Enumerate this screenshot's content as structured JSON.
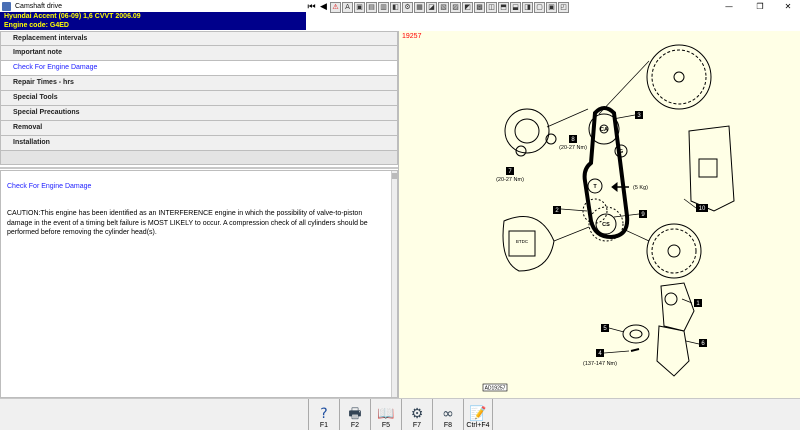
{
  "window": {
    "title": "Camshaft drive",
    "minimize": "—",
    "restore": "❐",
    "close": "✕"
  },
  "header": {
    "line1": "Hyundai    Accent (06-09) 1,6 CVVT 2006.09",
    "line2": "Engine code: G4ED"
  },
  "toolbar": {
    "buttons": [
      {
        "name": "first-page-icon",
        "glyph": "⏮"
      },
      {
        "name": "prev-page-icon",
        "glyph": "◀"
      },
      {
        "name": "warning-icon",
        "glyph": "⚠"
      },
      {
        "name": "info-icon",
        "glyph": "A"
      },
      {
        "name": "tool-1-icon",
        "glyph": "▣"
      },
      {
        "name": "tool-2-icon",
        "glyph": "▤"
      },
      {
        "name": "tool-3-icon",
        "glyph": "▥"
      },
      {
        "name": "tool-4-icon",
        "glyph": "◧"
      },
      {
        "name": "tool-5-icon",
        "glyph": "⚙"
      },
      {
        "name": "tool-6-icon",
        "glyph": "▦"
      },
      {
        "name": "tool-7-icon",
        "glyph": "◪"
      },
      {
        "name": "tool-8-icon",
        "glyph": "▧"
      },
      {
        "name": "tool-9-icon",
        "glyph": "▨"
      },
      {
        "name": "tool-10-icon",
        "glyph": "◩"
      },
      {
        "name": "tool-11-icon",
        "glyph": "▩"
      },
      {
        "name": "tool-12-icon",
        "glyph": "◫"
      },
      {
        "name": "tool-13-icon",
        "glyph": "⬒"
      },
      {
        "name": "tool-14-icon",
        "glyph": "⬓"
      },
      {
        "name": "tool-15-icon",
        "glyph": "◨"
      },
      {
        "name": "tool-16-icon",
        "glyph": "▢"
      },
      {
        "name": "tool-17-icon",
        "glyph": "▣"
      },
      {
        "name": "tool-18-icon",
        "glyph": "◰"
      }
    ]
  },
  "menu": {
    "items": [
      {
        "label": "Replacement intervals",
        "active": false
      },
      {
        "label": "Important note",
        "active": false
      },
      {
        "label": "Check For Engine Damage",
        "active": true
      },
      {
        "label": "Repair Times - hrs",
        "active": false
      },
      {
        "label": "Special Tools",
        "active": false
      },
      {
        "label": "Special Precautions",
        "active": false
      },
      {
        "label": "Removal",
        "active": false
      },
      {
        "label": "Installation",
        "active": false
      }
    ]
  },
  "content": {
    "heading": "Check For Engine Damage",
    "caution": "CAUTION:This engine has been identified as an INTERFERENCE engine in which the possibility of valve-to-piston damage in the event of a timing belt failure is MOST LIKELY to occur. A compression check of all cylinders should be performed before removing the cylinder head(s)."
  },
  "diagram": {
    "id": "19257",
    "footer_code": "AD19257",
    "labels": {
      "n1": "1",
      "n2": "2",
      "n3": "3",
      "n4": "4",
      "n5": "5",
      "n6": "6",
      "n7": "7",
      "n8": "8",
      "n9": "9",
      "n10": "10",
      "ca": "CA",
      "t": "T",
      "g": "G",
      "cs": "CS",
      "torque8": "(20-27 Nm)",
      "torque7": "(20-27 Nm)",
      "tension": "(5 Kg)",
      "torque4": "(137-147 Nm)",
      "btdc": "BTDC"
    }
  },
  "fkeys": [
    {
      "name": "help-key",
      "icon": "?",
      "label": "F1"
    },
    {
      "name": "print-key",
      "icon": "🖶",
      "label": "F2"
    },
    {
      "name": "book-key",
      "icon": "📖",
      "label": "F5"
    },
    {
      "name": "gear-key",
      "icon": "⚙",
      "label": "F7"
    },
    {
      "name": "belt-key",
      "icon": "∞",
      "label": "F8"
    },
    {
      "name": "notes-key",
      "icon": "📝",
      "label": "Ctrl+F4"
    }
  ]
}
